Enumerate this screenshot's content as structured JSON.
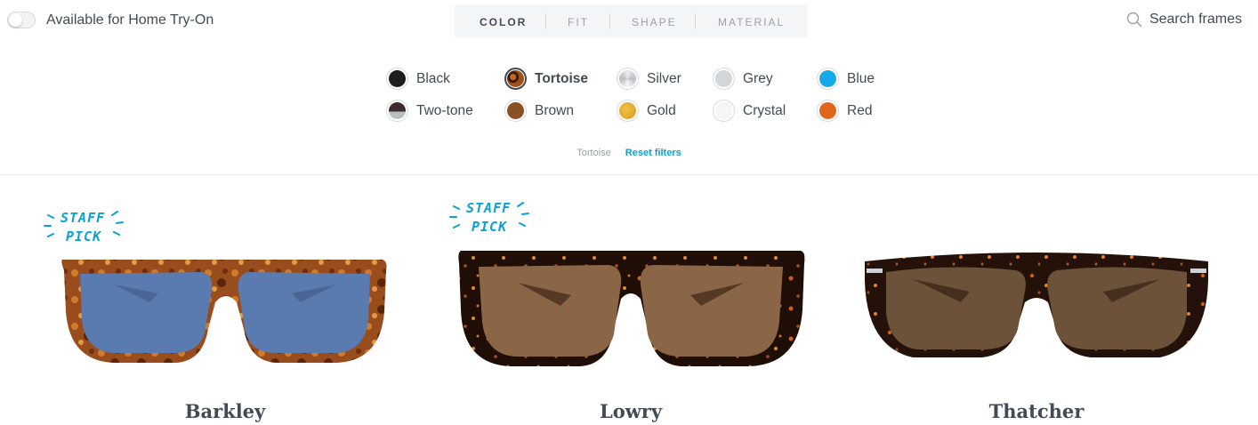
{
  "header": {
    "home_try_on_label": "Available for Home Try-On",
    "home_try_on_enabled": false,
    "tabs": [
      {
        "label": "COLOR",
        "active": true
      },
      {
        "label": "FIT",
        "active": false
      },
      {
        "label": "SHAPE",
        "active": false
      },
      {
        "label": "MATERIAL",
        "active": false
      }
    ],
    "search_label": "Search frames",
    "search_icon": "search-icon"
  },
  "colors": [
    {
      "label": "Black",
      "hex": "#1d1d1f",
      "selected": false
    },
    {
      "label": "Tortoise",
      "hex": "#7a3a14",
      "selected": true
    },
    {
      "label": "Silver",
      "hex": "#c9cdd1",
      "selected": false
    },
    {
      "label": "Grey",
      "hex": "#d3d6d9",
      "selected": false
    },
    {
      "label": "Blue",
      "hex": "#16a9e9",
      "selected": false
    },
    {
      "label": "Two-tone",
      "hex": "#3b2c28",
      "selected": false
    },
    {
      "label": "Brown",
      "hex": "#8a5127",
      "selected": false
    },
    {
      "label": "Gold",
      "hex": "#e2a72b",
      "selected": false
    },
    {
      "label": "Crystal",
      "hex": "#f4f5f6",
      "selected": false
    },
    {
      "label": "Red",
      "hex": "#e0661a",
      "selected": false
    }
  ],
  "filters": {
    "active_label": "Tortoise",
    "reset_label": "Reset filters"
  },
  "products": [
    {
      "name": "Barkley",
      "staff_pick": true,
      "frame_color": "#9a4d1c",
      "lens_color": "#5a7bb0"
    },
    {
      "name": "Lowry",
      "staff_pick": true,
      "frame_color": "#2a1408",
      "lens_color": "#8b6646"
    },
    {
      "name": "Thatcher",
      "staff_pick": false,
      "frame_color": "#24120a",
      "lens_color": "#6c5239"
    }
  ],
  "badge": {
    "line1": "STAFF",
    "line2": "PICK"
  },
  "accent": "#0aa1d6"
}
